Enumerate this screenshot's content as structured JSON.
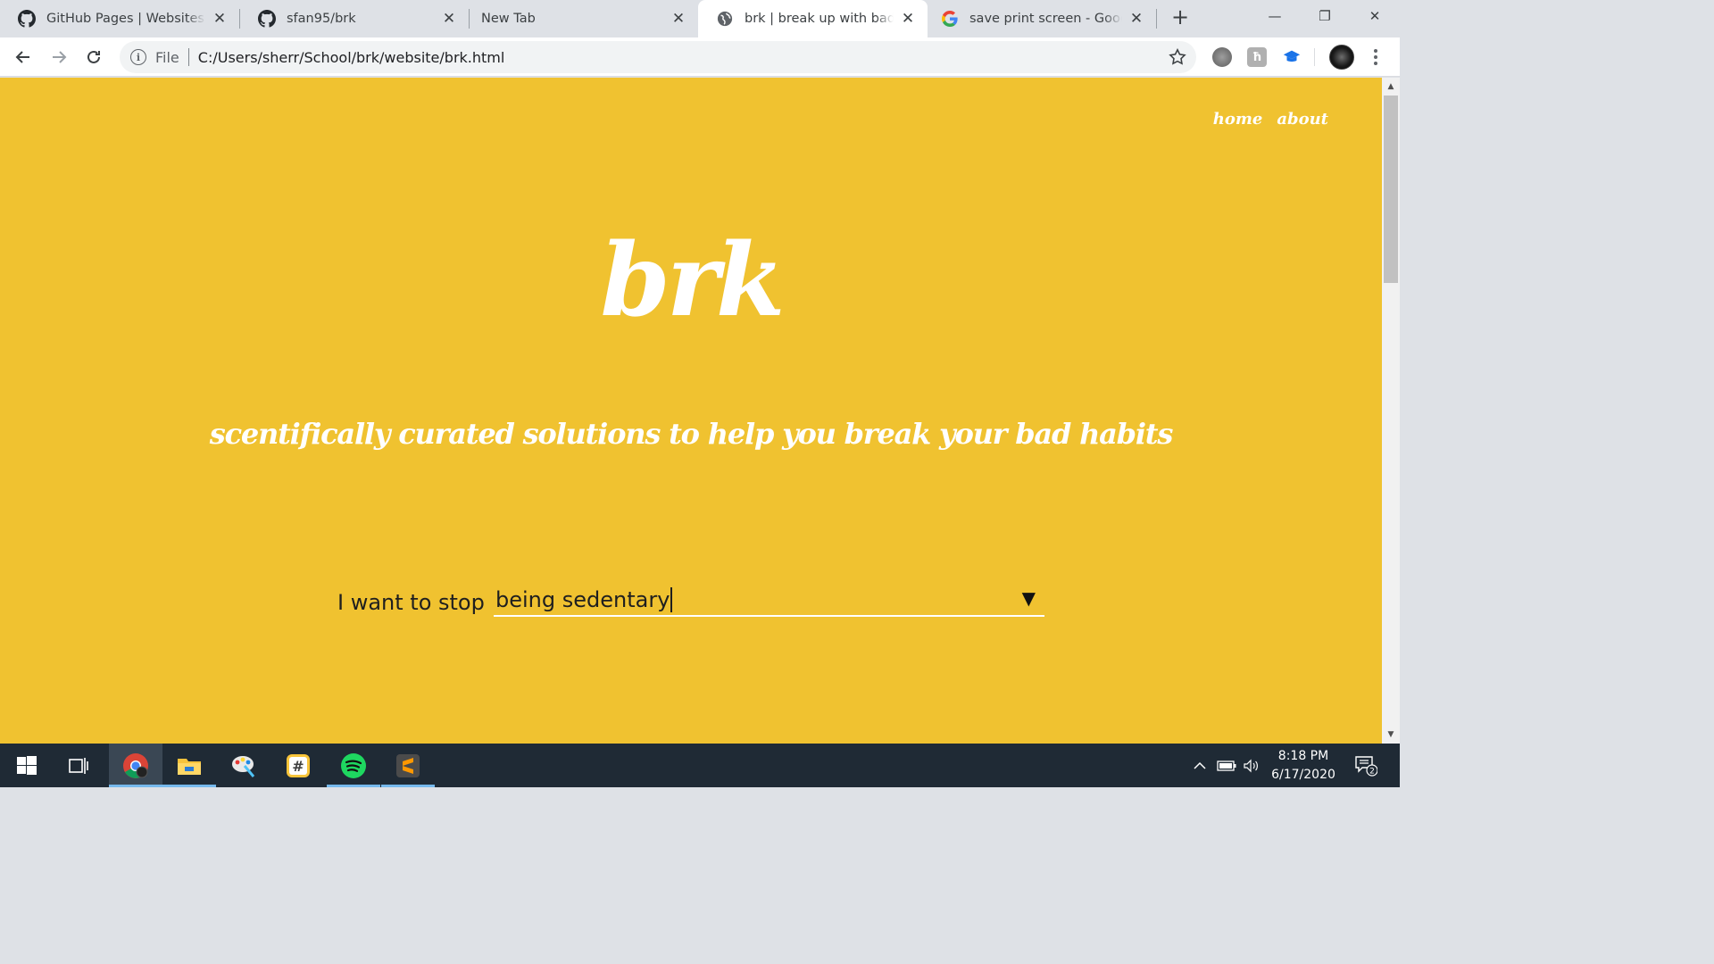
{
  "browser": {
    "tabs": [
      {
        "title": "GitHub Pages | Websites for",
        "icon": "github-icon"
      },
      {
        "title": "sfan95/brk",
        "icon": "github-icon"
      },
      {
        "title": "New Tab",
        "icon": ""
      },
      {
        "title": "brk | break up with bad habits",
        "icon": "globe-icon",
        "active": true
      },
      {
        "title": "save print screen - Google Search",
        "icon": "google-icon"
      }
    ],
    "new_tab_label": "+",
    "window_controls": {
      "minimize": "—",
      "restore": "❐",
      "close": "✕"
    },
    "omnibox": {
      "scheme_label": "File",
      "url": "C:/Users/sherr/School/brk/website/brk.html"
    }
  },
  "site": {
    "nav": {
      "home": "home",
      "about": "about"
    },
    "logo": "brk",
    "tagline": "scentifically curated solutions to help you break your bad habits",
    "form": {
      "label": "I want to stop",
      "selected_habit": "being sedentary",
      "dropdown_arrow": "▼"
    },
    "colors": {
      "background": "#f0c230",
      "text_light": "#ffffff",
      "text_dark": "#1f1f1f"
    }
  },
  "taskbar": {
    "apps": [
      "windows-start-icon",
      "task-view-icon",
      "chrome-icon",
      "file-explorer-icon",
      "paint-icon",
      "slack-icon",
      "spotify-icon",
      "sublime-text-icon"
    ],
    "clock_time": "8:18 PM",
    "clock_date": "6/17/2020",
    "notification_count": "2"
  }
}
